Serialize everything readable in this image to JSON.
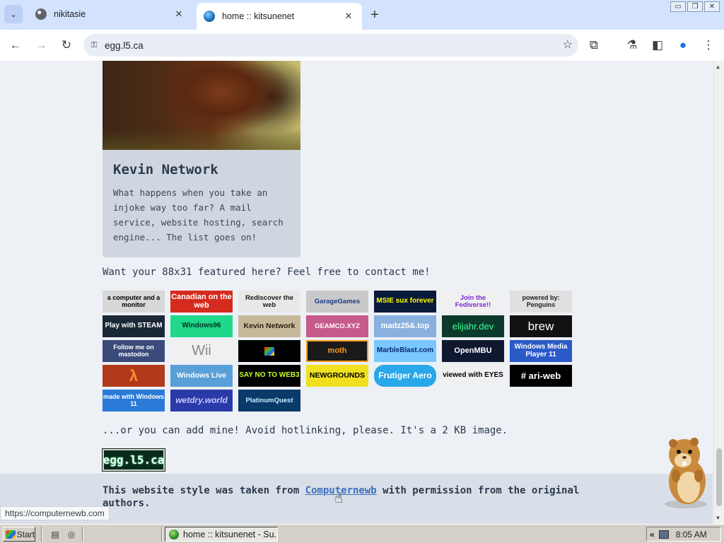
{
  "window": {
    "minimize_glyph": "▭",
    "restore_glyph": "❐",
    "close_glyph": "✕"
  },
  "tabs": [
    {
      "title": "nikitasie",
      "active": false
    },
    {
      "title": "home :: kitsunenet",
      "active": true
    }
  ],
  "tabstrip": {
    "menu_glyph": "⌄",
    "close_glyph": "✕",
    "newtab_glyph": "+"
  },
  "toolbar": {
    "back_glyph": "←",
    "forward_glyph": "→",
    "reload_glyph": "↻",
    "url": "egg.l5.ca",
    "lock_glyph": "⚿",
    "star_glyph": "☆",
    "extensions_glyph": "⧉",
    "labs_glyph": "⚗",
    "sidepanel_glyph": "◧",
    "profile_glyph": "●",
    "menu_glyph": "⋮"
  },
  "card": {
    "title": "Kevin Network",
    "description": "What happens when you take an injoke way too far? A mail service, website hosting, search engine... The list goes on!"
  },
  "feature_text": "Want your 88x31 featured here? Feel free to contact me!",
  "buttons": [
    {
      "text": "a computer and a monitor",
      "bg": "#d8d8d8",
      "fg": "#000000"
    },
    {
      "text": "Canadian on the web",
      "bg": "#d52b1e",
      "fg": "#ffffff"
    },
    {
      "text": "Rediscover the web",
      "bg": "#e8e8e8",
      "fg": "#1a1a1a"
    },
    {
      "text": "GarageGames",
      "bg": "#c9c9c9",
      "fg": "#1a3a8a"
    },
    {
      "text": "MSIE sux forever",
      "bg": "#0a1a3a",
      "fg": "#ffff00"
    },
    {
      "text": "Join the Fediverse!!",
      "bg": "#f0f0f0",
      "fg": "#7a2ad0"
    },
    {
      "text": "powered by: Penguins",
      "bg": "#e0e0e0",
      "fg": "#222222"
    },
    {
      "text": "Play with STEAM",
      "bg": "#1b2838",
      "fg": "#ffffff"
    },
    {
      "text": "Windows96",
      "bg": "#1fd88a",
      "fg": "#003322"
    },
    {
      "text": "Kevin Network",
      "bg": "#c8b89a",
      "fg": "#2a1a0a"
    },
    {
      "text": "GEAMCO.XYZ",
      "bg": "#c65a8a",
      "fg": "#ffffff"
    },
    {
      "text": "madz25&.top",
      "bg": "#8ab0e0",
      "fg": "#ffffff"
    },
    {
      "text": "elijahr.dev",
      "bg": "#0c3a2a",
      "fg": "#3cff9c"
    },
    {
      "text": "brew",
      "bg": "#111111",
      "fg": "#ffffff"
    },
    {
      "text": "Follow me on mastodon",
      "bg": "#3a4a7a",
      "fg": "#ffffff"
    },
    {
      "text": "Wii",
      "bg": "#f0f0f0",
      "fg": "#888888"
    },
    {
      "text": "",
      "bg": "#000000",
      "fg": "#ffffff"
    },
    {
      "text": "moth",
      "bg": "#1a1a1a",
      "fg": "#ff9a1a"
    },
    {
      "text": "MarbleBlast.com",
      "bg": "#7ac8ff",
      "fg": "#0a2a6a"
    },
    {
      "text": "OpenMBU",
      "bg": "#101830",
      "fg": "#ffffff"
    },
    {
      "text": "Windows Media Player 11",
      "bg": "#2a5ac8",
      "fg": "#ffffff"
    },
    {
      "text": "λ",
      "bg": "#b03a1a",
      "fg": "#ff8a3a"
    },
    {
      "text": "Windows Live",
      "bg": "#5aa0d8",
      "fg": "#ffffff"
    },
    {
      "text": "SAY NO TO WEB3",
      "bg": "#000000",
      "fg": "#c8ff2a"
    },
    {
      "text": "NEWGROUNDS",
      "bg": "#f0e020",
      "fg": "#000000"
    },
    {
      "text": "Frutiger Aero",
      "bg": "#28a8e8",
      "fg": "#ffffff"
    },
    {
      "text": "viewed with EYES",
      "bg": "#f0f0f0",
      "fg": "#000000"
    },
    {
      "text": "# ari-web",
      "bg": "#000000",
      "fg": "#ffffff"
    },
    {
      "text": "made with Windows 11",
      "bg": "#2a7ad8",
      "fg": "#ffffff"
    },
    {
      "text": "wetdry.world",
      "bg": "#2a3aa8",
      "fg": "#c8c8ff"
    },
    {
      "text": "PlatinumQuest",
      "bg": "#0a3a6a",
      "fg": "#c8f0ff"
    }
  ],
  "mine_text": "...or you can add mine! Avoid hotlinking, please. It's a 2 KB image.",
  "egg_badge": "egg.l5.ca",
  "footer": {
    "prefix": "This website style was taken from ",
    "link": "Computernewb",
    "suffix": " with permission from the original authors."
  },
  "status_url": "https://computernewb.com",
  "taskbar": {
    "start_label": "Start",
    "task_label": "home :: kitsunenet - Su...",
    "tray_chevron": "«",
    "clock": "8:05 AM"
  }
}
